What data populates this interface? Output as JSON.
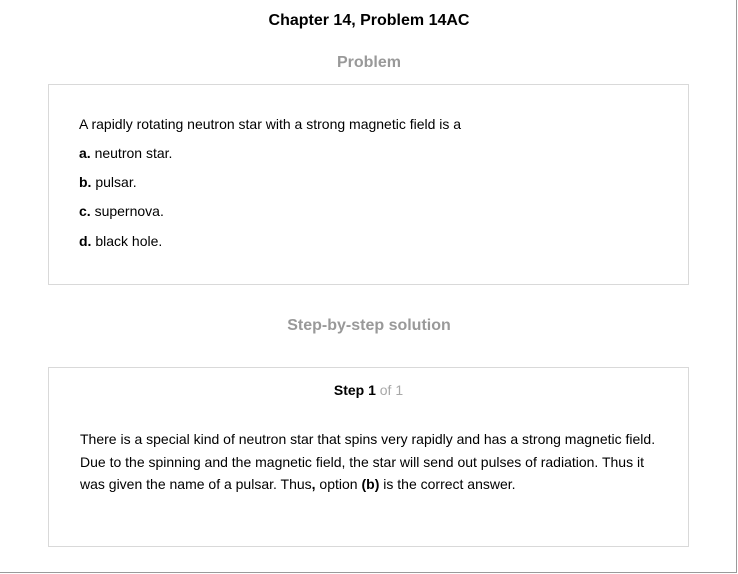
{
  "title": "Chapter 14, Problem 14AC",
  "problem": {
    "heading": "Problem",
    "question": "A rapidly rotating neutron star with a strong magnetic field is a",
    "options": [
      {
        "letter": "a.",
        "text": "neutron star."
      },
      {
        "letter": "b.",
        "text": "pulsar."
      },
      {
        "letter": "c.",
        "text": "supernova."
      },
      {
        "letter": "d.",
        "text": "black hole."
      }
    ]
  },
  "solution": {
    "heading": "Step-by-step solution",
    "step": {
      "word": "Step 1",
      "of": "of 1"
    },
    "text_part1": "There is a special kind of neutron star that spins very rapidly and has a strong magnetic field. Due to the spinning and the magnetic field, the star will send out pulses of radiation. Thus it was given the name of a pulsar. Thus",
    "text_comma": ",",
    "text_part2": " option ",
    "text_answer": "(b)",
    "text_part3": " is the correct answer."
  }
}
